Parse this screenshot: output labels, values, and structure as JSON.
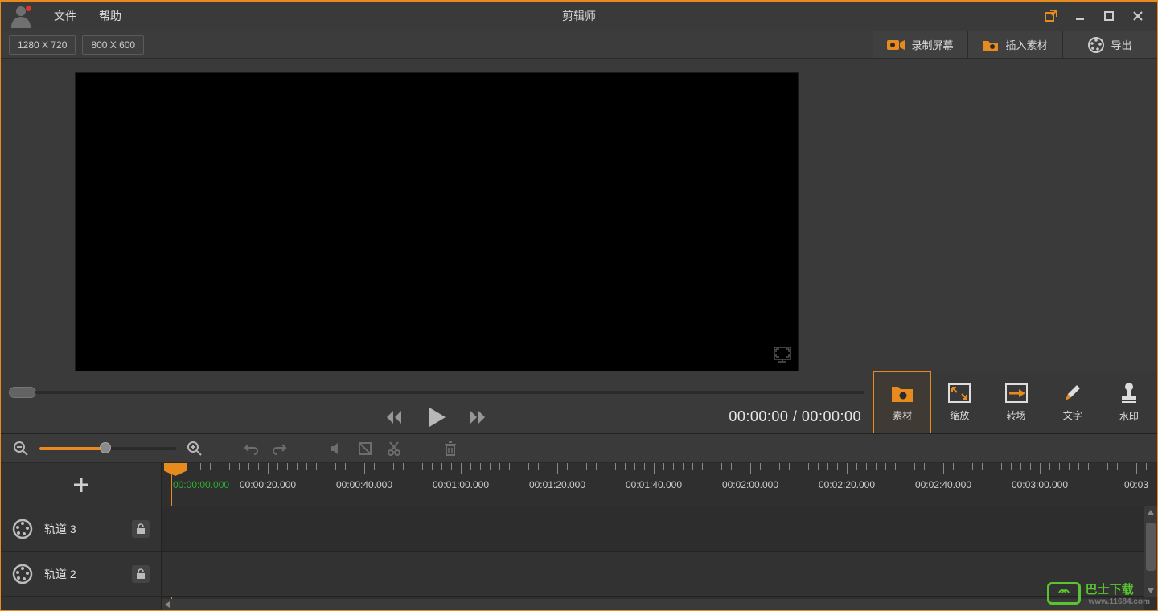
{
  "app": {
    "title": "剪辑师",
    "menu": {
      "file": "文件",
      "help": "帮助"
    }
  },
  "resolutions": {
    "r1": "1280 X 720",
    "r2": "800 X 600"
  },
  "playback": {
    "current": "00:00:00",
    "sep": " / ",
    "total": "00:00:00"
  },
  "actions": {
    "record": "录制屏幕",
    "insert": "插入素材",
    "export": "导出"
  },
  "tabs": {
    "material": "素材",
    "zoom": "缩放",
    "transition": "转场",
    "text": "文字",
    "watermark": "水印"
  },
  "timeline": {
    "playhead_time": "00:00:00.000",
    "labels": [
      "00:00:20.000",
      "00:00:40.000",
      "00:01:00.000",
      "00:01:20.000",
      "00:01:40.000",
      "00:02:00.000",
      "00:02:20.000",
      "00:02:40.000",
      "00:03:00.000",
      "00:03"
    ],
    "tracks": [
      {
        "name": "轨道 3"
      },
      {
        "name": "轨道 2"
      }
    ]
  },
  "branding": {
    "main": "巴士下载",
    "url": "www.11684.com"
  }
}
